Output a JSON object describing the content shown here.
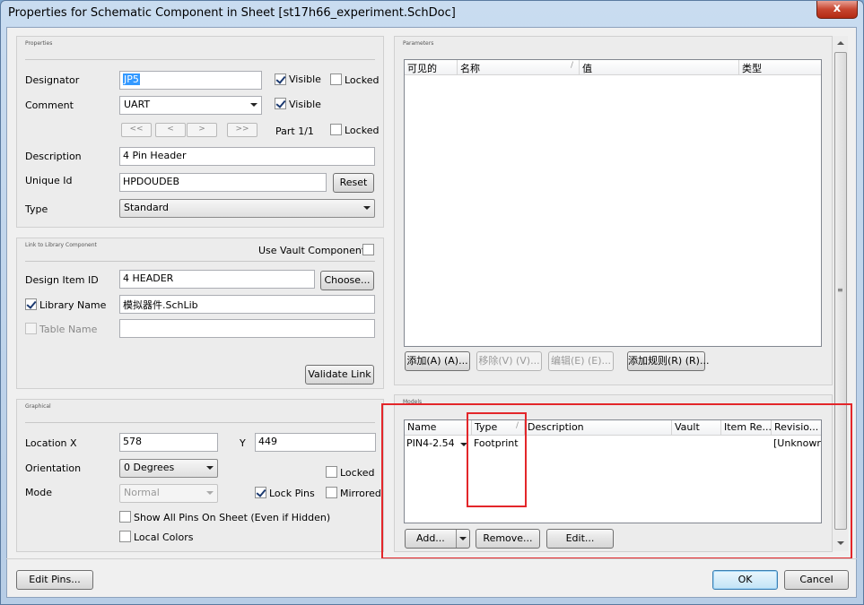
{
  "window": {
    "title": "Properties for Schematic Component in Sheet [st17h66_experiment.SchDoc]",
    "close_glyph": "x"
  },
  "properties": {
    "title": "Properties",
    "designator_label": "Designator",
    "designator_value": "JP5",
    "visible1_label": "Visible",
    "locked1_label": "Locked",
    "comment_label": "Comment",
    "comment_value": "UART",
    "visible2_label": "Visible",
    "nav_first": "<<",
    "nav_prev": "<",
    "nav_next": ">",
    "nav_last": ">>",
    "part_label": "Part 1/1",
    "locked2_label": "Locked",
    "description_label": "Description",
    "description_value": "4 Pin Header",
    "uniqueid_label": "Unique Id",
    "uniqueid_value": "HPDOUDEB",
    "reset_button": "Reset",
    "type_label": "Type",
    "type_value": "Standard"
  },
  "library": {
    "title": "Link to Library Component",
    "use_vault_label": "Use Vault Component",
    "design_item_label": "Design Item ID",
    "design_item_value": "4 HEADER",
    "choose_button": "Choose...",
    "library_name_label": "Library Name",
    "library_name_value": "模拟器件.SchLib",
    "table_name_label": "Table Name",
    "table_name_value": "",
    "validate_button": "Validate Link"
  },
  "graphical": {
    "title": "Graphical",
    "location_label": "Location  X",
    "x_value": "578",
    "y_label": "Y",
    "y_value": "449",
    "orientation_label": "Orientation",
    "orientation_value": "0 Degrees",
    "locked_label": "Locked",
    "mode_label": "Mode",
    "mode_value": "Normal",
    "lockpins_label": "Lock Pins",
    "mirrored_label": "Mirrored",
    "show_all_pins_label": "Show All Pins On Sheet (Even if Hidden)",
    "local_colors_label": "Local Colors"
  },
  "parameters": {
    "title": "Parameters",
    "columns": [
      "可见的",
      "名称",
      "值",
      "类型"
    ],
    "sort_glyph": "/",
    "add_button": "添加(A) (A)...",
    "remove_button": "移除(V) (V)...",
    "edit_button": "编辑(E) (E)...",
    "add_rule_button": "添加规则(R) (R)..."
  },
  "models": {
    "title": "Models",
    "columns": [
      "Name",
      "Type",
      "Description",
      "Vault",
      "Item Re...",
      "Revisio..."
    ],
    "sort_glyph": "/",
    "rows": [
      {
        "name": "PIN4-2.54",
        "type": "Footprint",
        "description": "",
        "vault": "",
        "item_rev": "",
        "revision": "[Unknowr"
      }
    ],
    "add_button": "Add...",
    "remove_button": "Remove...",
    "edit_button": "Edit..."
  },
  "footer": {
    "edit_pins_button": "Edit Pins...",
    "ok_button": "OK",
    "cancel_button": "Cancel"
  },
  "colors": {
    "highlight_box": "#e3262a",
    "selection": "#3399ff"
  }
}
